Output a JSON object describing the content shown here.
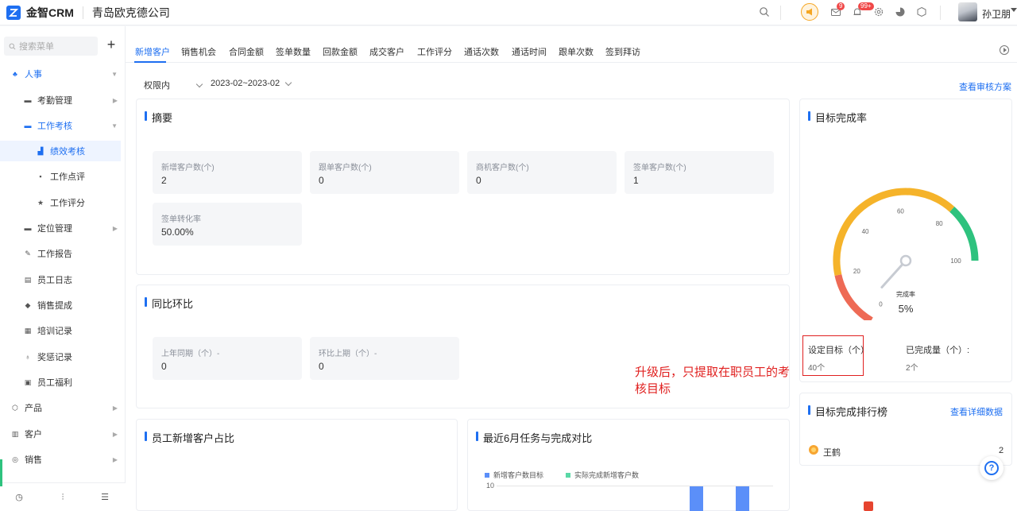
{
  "header": {
    "app_name": "金智CRM",
    "company": "青岛欧克德公司",
    "mail_badge": "9",
    "bell_badge": "99+",
    "user_name": "孙卫朋"
  },
  "sidebar": {
    "search_placeholder": "搜索菜单",
    "add_label": "+",
    "items": [
      {
        "label": "人事"
      },
      {
        "label": "考勤管理"
      },
      {
        "label": "工作考核"
      },
      {
        "label": "绩效考核"
      },
      {
        "label": "工作点评"
      },
      {
        "label": "工作评分"
      },
      {
        "label": "定位管理"
      },
      {
        "label": "工作报告"
      },
      {
        "label": "员工日志"
      },
      {
        "label": "销售提成"
      },
      {
        "label": "培训记录"
      },
      {
        "label": "奖惩记录"
      },
      {
        "label": "员工福利"
      },
      {
        "label": "产品"
      },
      {
        "label": "客户"
      },
      {
        "label": "销售"
      }
    ]
  },
  "tabs": [
    "新增客户",
    "销售机会",
    "合同金额",
    "签单数量",
    "回款金额",
    "成交客户",
    "工作评分",
    "通话次数",
    "通话时间",
    "跟单次数",
    "签到拜访"
  ],
  "filters": {
    "scope": "权限内",
    "date_range": "2023-02~2023-02",
    "audit_link": "查看审核方案"
  },
  "summary": {
    "title": "摘要",
    "stats": [
      {
        "label": "新增客户数(个)",
        "value": "2"
      },
      {
        "label": "跟单客户数(个)",
        "value": "0"
      },
      {
        "label": "商机客户数(个)",
        "value": "0"
      },
      {
        "label": "签单客户数(个)",
        "value": "1"
      },
      {
        "label": "签单转化率",
        "value": "50.00%"
      }
    ]
  },
  "yoy": {
    "title": "同比环比",
    "stats": [
      {
        "label": "上年同期（个）-",
        "value": "0"
      },
      {
        "label": "环比上期（个）-",
        "value": "0"
      }
    ]
  },
  "ratio_card": {
    "title": "员工新增客户占比"
  },
  "trend_card": {
    "title": "最近6月任务与完成对比",
    "legend": [
      "新增客户数目标",
      "实际完成新增客户数"
    ],
    "y_tick": "10"
  },
  "gauge": {
    "title": "目标完成率",
    "ticks": [
      "0",
      "20",
      "40",
      "60",
      "80",
      "100"
    ],
    "center_label": "完成率",
    "value_text": "5%",
    "value": 5,
    "colors": {
      "low": "#ee6a55",
      "mid": "#f5b32a",
      "high": "#2ec27e",
      "needle": "#c7cbd2"
    }
  },
  "target": {
    "set_label": "设定目标（个）",
    "set_value": "40个",
    "done_label": "已完成量（个）:",
    "done_value": "2个"
  },
  "annotation": "升级后，只提取在职员工的考核目标",
  "ranking": {
    "title": "目标完成排行榜",
    "detail_link": "查看详细数据",
    "rows": [
      {
        "name": "王鹤",
        "value": "2"
      }
    ]
  },
  "help_label": "?"
}
